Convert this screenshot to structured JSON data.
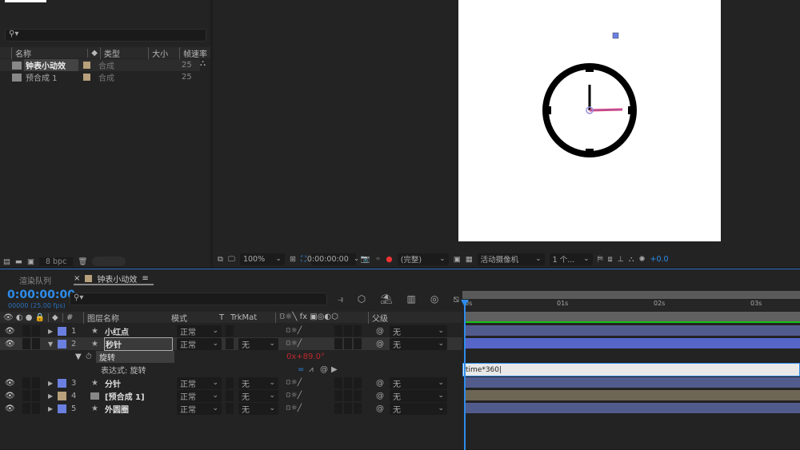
{
  "project": {
    "search_placeholder": "",
    "columns": {
      "name": "名称",
      "type": "类型",
      "size": "大小",
      "fps": "帧速率"
    },
    "items": [
      {
        "name": "钟表小动效",
        "type": "合成",
        "fps": "25",
        "color": "#b7a07b"
      },
      {
        "name": "预合成 1",
        "type": "合成",
        "fps": "25",
        "color": "#b7a07b"
      }
    ],
    "bpc": "8 bpc"
  },
  "viewer": {
    "zoom": "100%",
    "timecode": "0:00:00:00",
    "resolution": "(完整)",
    "camera": "活动摄像机",
    "views": "1 个...",
    "exposure": "+0.0"
  },
  "timeline": {
    "tabs": {
      "render_queue": "渲染队列",
      "comp": "钟表小动效"
    },
    "timecode": "0:00:00:00",
    "frame_info": "00000 (25.00 fps)",
    "columns": {
      "layer_name": "图层名称",
      "mode": "模式",
      "t": "T",
      "trkmat": "TrkMat",
      "parent": "父级",
      "num": "#"
    },
    "layers": [
      {
        "num": "1",
        "name": "小红点",
        "mode": "正常",
        "trkmat": "",
        "parent": "无",
        "color": "#6a7fe0",
        "type": "shape"
      },
      {
        "num": "2",
        "name": "秒针",
        "mode": "正常",
        "trkmat": "无",
        "parent": "无",
        "color": "#6a7fe0",
        "type": "shape",
        "selected": true
      },
      {
        "num": "3",
        "name": "分针",
        "mode": "正常",
        "trkmat": "无",
        "parent": "无",
        "color": "#6a7fe0",
        "type": "shape"
      },
      {
        "num": "4",
        "name": "[预合成 1]",
        "mode": "正常",
        "trkmat": "无",
        "parent": "无",
        "color": "#b7a07b",
        "type": "comp"
      },
      {
        "num": "5",
        "name": "外圆圈",
        "mode": "正常",
        "trkmat": "无",
        "parent": "无",
        "color": "#6a7fe0",
        "type": "shape"
      }
    ],
    "property": {
      "name": "旋转",
      "value_rev": "0x",
      "value_deg": "+89.0°"
    },
    "expression": {
      "label": "表达式: 旋转",
      "text": "time*360"
    },
    "ruler": [
      "0s",
      "01s",
      "02s",
      "03s"
    ],
    "colors": {
      "accent": "#2d8ceb",
      "bar_shape": "#525c8c",
      "bar_comp": "#6e6655",
      "work_area": "#18c418"
    }
  }
}
